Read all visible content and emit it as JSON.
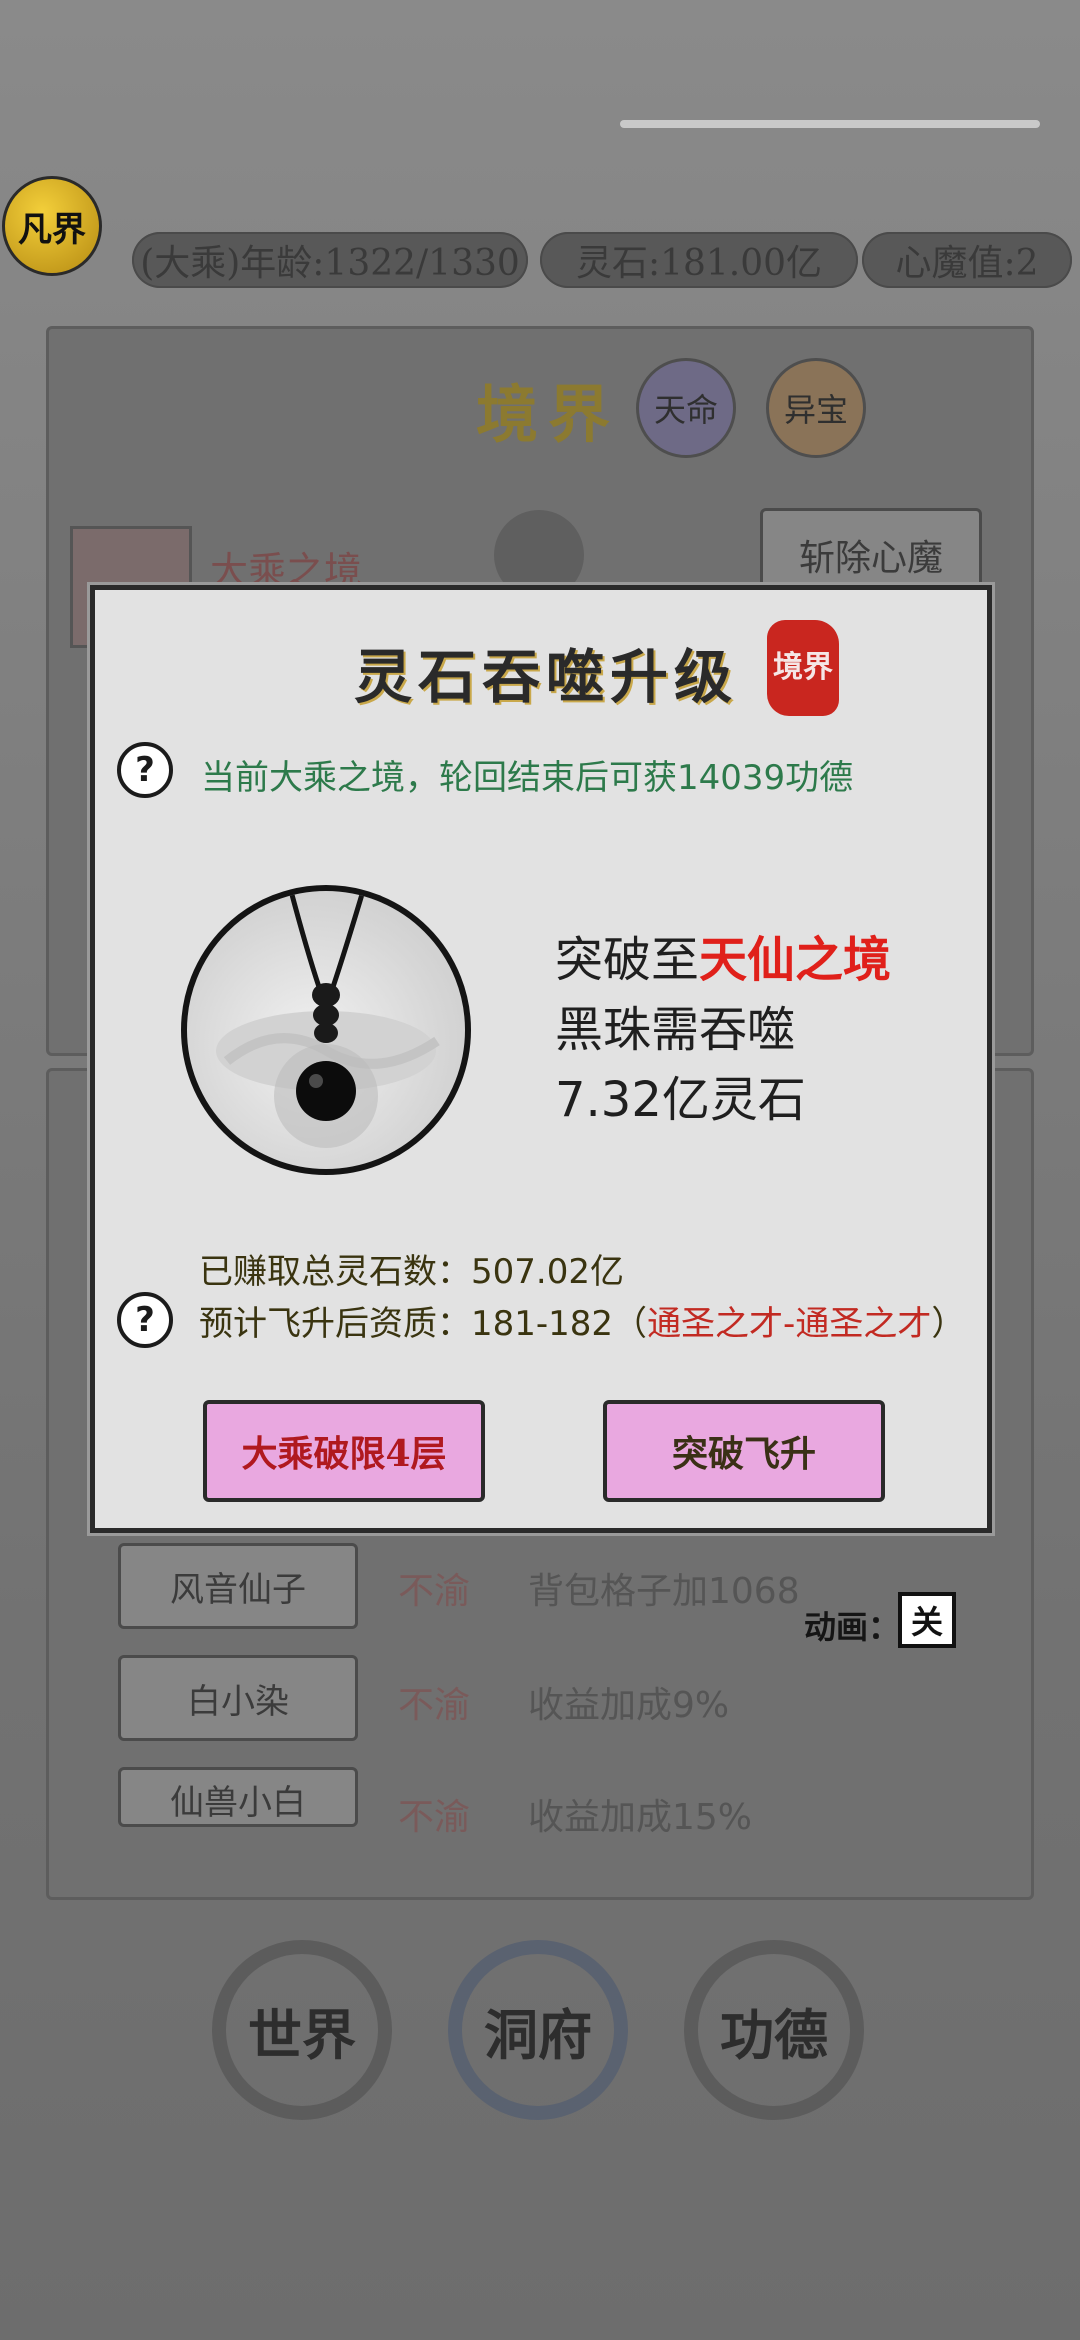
{
  "header": {
    "avatar_text": "凡界",
    "age_label": "(大乘)年龄:1322/1330",
    "spirit_stones": "灵石:181.00亿",
    "heart_demon": "心魔值:2"
  },
  "realm_panel": {
    "title": "境界",
    "tab_tianming": "天命",
    "tab_yibao": "异宝",
    "current_realm": "大乘之境",
    "slay_demon_button": "斩除心魔"
  },
  "modal": {
    "title": "灵石吞噬升级",
    "seal_text": "境界",
    "info_line": "当前大乘之境，轮回结束后可获14039功德",
    "breakthrough_prefix": "突破至",
    "breakthrough_target": "天仙之境",
    "consume_line": "黑珠需吞噬",
    "cost_line": "7.32亿灵石",
    "earned_total": "已赚取总灵石数：507.02亿",
    "expected_quality_prefix": "预计飞升后资质：181-182（",
    "expected_quality_range": "通圣之才-通圣之才",
    "expected_quality_suffix": "）",
    "button_left": "大乘破限4层",
    "button_right": "突破飞升"
  },
  "companions": [
    {
      "name": "风音仙子",
      "status": "不渝",
      "bonus": "背包格子加1068"
    },
    {
      "name": "白小染",
      "status": "不渝",
      "bonus": "收益加成9%"
    },
    {
      "name": "仙兽小白",
      "status": "不渝",
      "bonus": "收益加成15%"
    }
  ],
  "animation": {
    "label": "动画：",
    "toggle": "关"
  },
  "bottom_nav": {
    "world": "世界",
    "cave": "洞府",
    "merit": "功德"
  }
}
